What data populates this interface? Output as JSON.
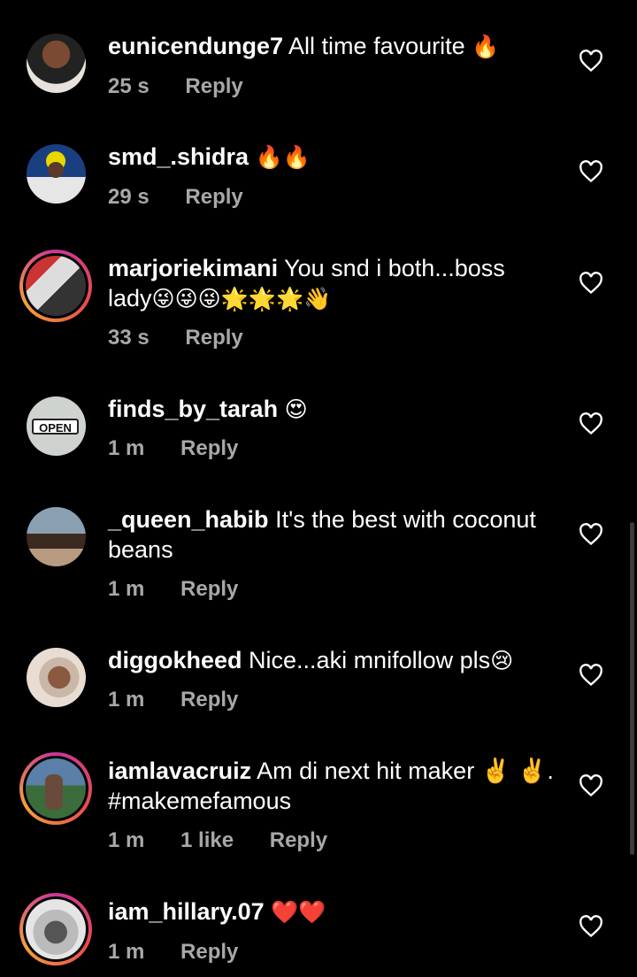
{
  "comments": [
    {
      "username": "eunicendunge7",
      "text": "All time favourite",
      "emoji": "🔥",
      "time": "25 s",
      "likes": "",
      "reply": "Reply"
    },
    {
      "username": "smd_.shidra",
      "text": "",
      "emoji": "🔥🔥",
      "time": "29 s",
      "likes": "",
      "reply": "Reply"
    },
    {
      "username": "marjoriekimani",
      "text": "You snd i both...boss lady",
      "emoji": "😜😜😜🌟🌟🌟👋",
      "time": "33 s",
      "likes": "",
      "reply": "Reply"
    },
    {
      "username": "finds_by_tarah",
      "text": "",
      "emoji": "😍",
      "time": "1 m",
      "likes": "",
      "reply": "Reply",
      "avatar_text": "OPEN"
    },
    {
      "username": "_queen_habib",
      "text": "It's the best with coconut beans",
      "emoji": "",
      "time": "1 m",
      "likes": "",
      "reply": "Reply"
    },
    {
      "username": "diggokheed",
      "text": "Nice...aki mnifollow pls",
      "emoji": "😢",
      "time": "1 m",
      "likes": "",
      "reply": "Reply"
    },
    {
      "username": "iamlavacruiz",
      "text": "Am di next hit maker ✌️ ✌️. #makemefamous",
      "emoji": "",
      "time": "1 m",
      "likes": "1 like",
      "reply": "Reply"
    },
    {
      "username": "iam_hillary.07",
      "text": "",
      "emoji": "❤️❤️",
      "time": "1 m",
      "likes": "",
      "reply": "Reply"
    }
  ],
  "colors": {
    "background": "#000000",
    "text": "#ffffff",
    "meta": "#a8a8a8",
    "story_ring": "#e1306c"
  },
  "icons": {
    "like": "heart-outline-icon"
  }
}
